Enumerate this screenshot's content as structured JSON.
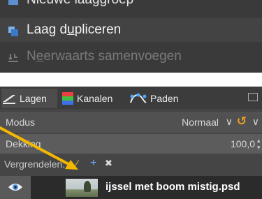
{
  "context_menu": {
    "items": [
      {
        "label": "Nieuwe laaggroep",
        "enabled": true
      },
      {
        "label_pre": "Laag d",
        "label_mn": "u",
        "label_post": "pliceren",
        "enabled": true
      },
      {
        "label_pre": "N",
        "label_mn": "e",
        "label_post": "erwaarts samenvoegen",
        "enabled": false
      }
    ]
  },
  "dock": {
    "tabs": [
      {
        "label": "Lagen",
        "icon": "layers-icon",
        "active": true
      },
      {
        "label": "Kanalen",
        "icon": "channels-icon",
        "active": false
      },
      {
        "label": "Paden",
        "icon": "paths-icon",
        "active": false
      }
    ],
    "mode": {
      "label": "Modus",
      "value": "Normaal"
    },
    "opacity": {
      "label": "Dekking",
      "value": "100,0",
      "fraction": 1.0
    },
    "lock": {
      "label": "Vergrendelen:",
      "icons": [
        "lock-pixels-icon",
        "lock-position-icon",
        "lock-alpha-icon"
      ]
    },
    "layer": {
      "name": "ijssel met boom mistig.psd",
      "visible": true
    }
  },
  "colors": {
    "accent_orange": "#f0a020",
    "arrow_yellow": "#f5b800",
    "lock_blue": "#6aa8ff"
  }
}
